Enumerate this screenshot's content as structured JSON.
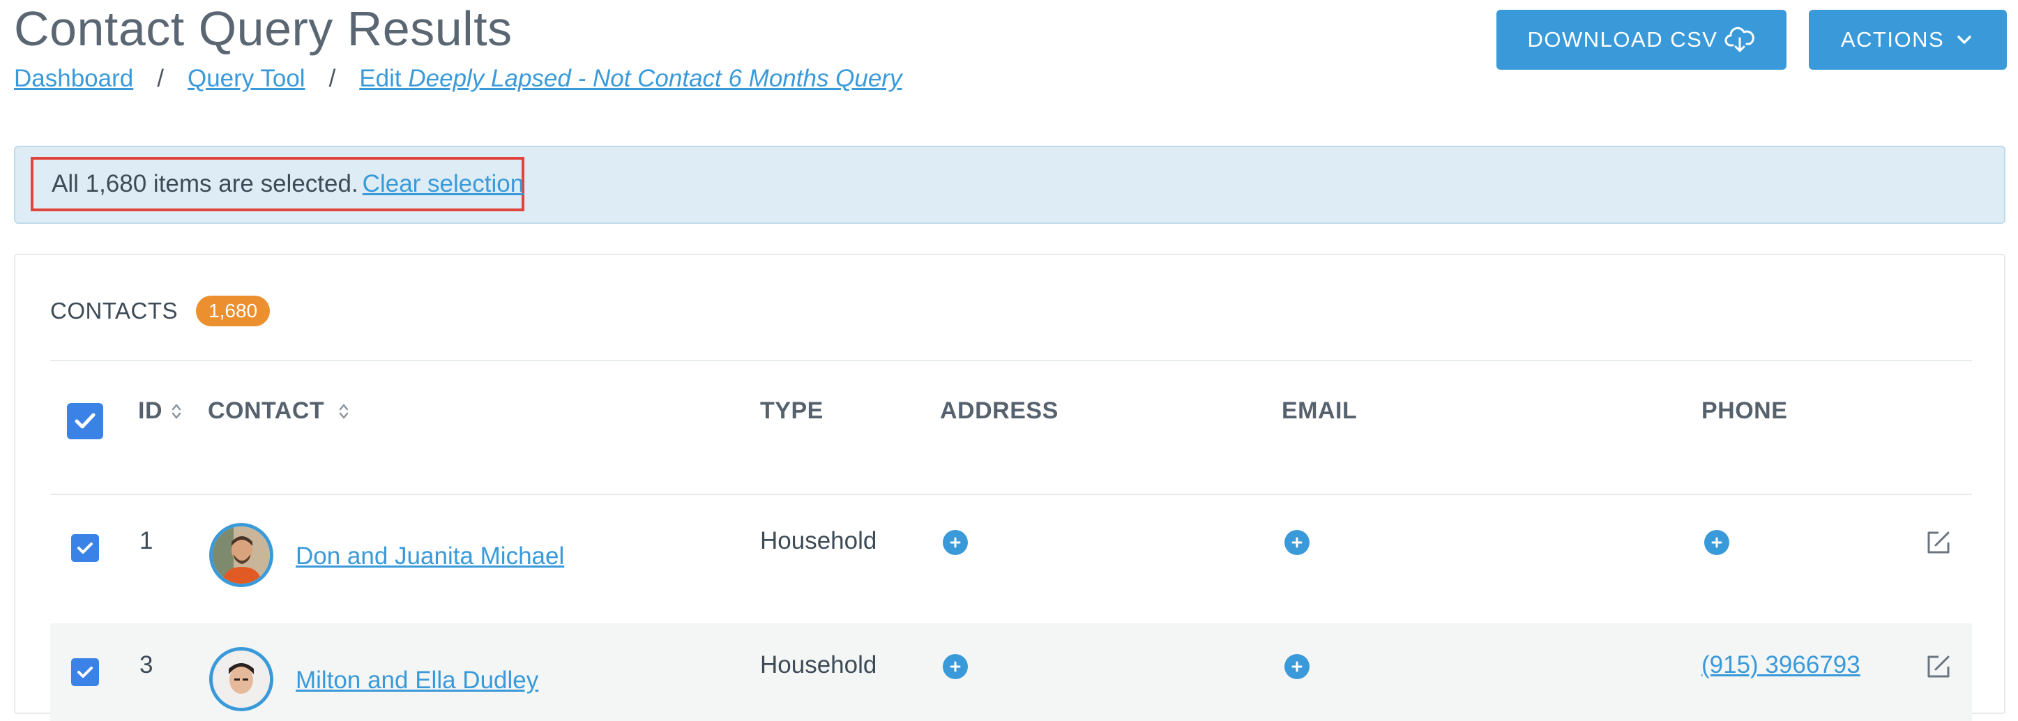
{
  "header": {
    "title": "Contact Query Results",
    "breadcrumb": {
      "items": [
        "Dashboard",
        "Query Tool"
      ],
      "current_prefix": "Edit",
      "current_name": "Deeply Lapsed - Not Contact 6 Months Query",
      "separator": "/"
    },
    "buttons": {
      "download_label": "DOWNLOAD CSV",
      "download_icon": "cloud-download-icon",
      "actions_label": "ACTIONS",
      "actions_icon": "chevron-down-icon"
    }
  },
  "selection_alert": {
    "message": "All 1,680 items are selected.",
    "clear_link": "Clear selection"
  },
  "contacts": {
    "heading": "CONTACTS",
    "count_badge": "1,680",
    "columns": [
      "ID",
      "CONTACT",
      "TYPE",
      "ADDRESS",
      "EMAIL",
      "PHONE"
    ],
    "select_all_checked": true,
    "rows": [
      {
        "checked": true,
        "id": "1",
        "name": "Don and Juanita Michael",
        "type": "Household",
        "address": "add-icon",
        "email": "add-icon",
        "phone": "add-icon"
      },
      {
        "checked": true,
        "id": "3",
        "name": "Milton and Ella Dudley",
        "type": "Household",
        "address": "add-icon",
        "email": "add-icon",
        "phone": "(915) 3966793"
      }
    ]
  },
  "colors": {
    "accent": "#3a9ad9",
    "checkbox": "#3a82e6",
    "badge": "#ec8f2f",
    "alert_bg": "#deedf5",
    "highlight_border": "#e0443a"
  }
}
